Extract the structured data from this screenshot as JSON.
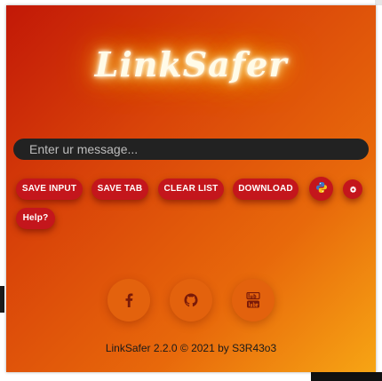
{
  "app": {
    "logo_text": "LinkSafer"
  },
  "message": {
    "placeholder": "Enter ur message...",
    "value": ""
  },
  "buttons": {
    "save_input": "SAVE INPUT",
    "save_tab": "SAVE TAB",
    "clear_list": "CLEAR LIST",
    "download": "DOWNLOAD",
    "help": "Help?"
  },
  "icons": {
    "python": "python-icon",
    "settings": "gear-icon",
    "facebook": "facebook-icon",
    "github": "github-icon",
    "youtube": "youtube-icon"
  },
  "footer": {
    "text": "LinkSafer 2.2.0 © 2021 by S3R43o3"
  },
  "colors": {
    "gradient_start": "#c21807",
    "gradient_end": "#f7a514",
    "button": "#c4161c",
    "input_bg": "#222222",
    "social_bg": "#e3620d",
    "social_icon": "#7a1a08"
  }
}
